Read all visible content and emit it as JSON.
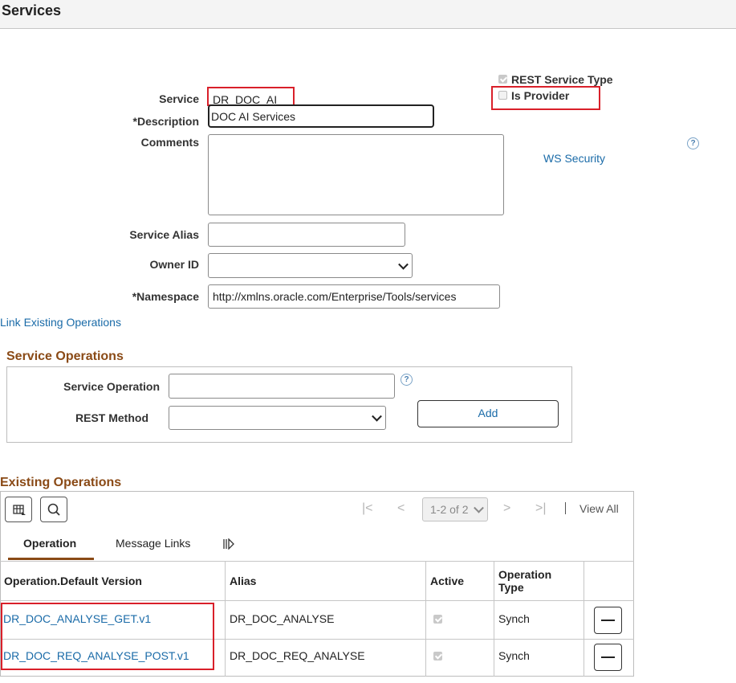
{
  "page": {
    "title": "Services"
  },
  "service_form": {
    "service_label": "Service",
    "service_value": "DR_DOC_AI",
    "description_label": "*Description",
    "description_value": "DOC AI Services",
    "comments_label": "Comments",
    "comments_value": "",
    "service_alias_label": "Service Alias",
    "service_alias_value": "",
    "owner_id_label": "Owner ID",
    "owner_id_value": "",
    "namespace_label": "*Namespace",
    "namespace_value": "http://xmlns.oracle.com/Enterprise/Tools/services",
    "rest_service_type_label": "REST Service Type",
    "rest_service_type_checked": true,
    "is_provider_label": "Is Provider",
    "is_provider_checked": false,
    "ws_security_link": "WS Security",
    "link_existing_ops": "Link Existing Operations",
    "help_glyph": "?"
  },
  "service_operations": {
    "title": "Service Operations",
    "service_operation_label": "Service Operation",
    "service_operation_value": "",
    "rest_method_label": "REST Method",
    "rest_method_value": "",
    "add_button": "Add",
    "help_glyph": "?"
  },
  "existing_operations": {
    "title": "Existing Operations",
    "pager": "1-2 of 2",
    "view_all": "View All",
    "tabs": [
      "Operation",
      "Message Links"
    ],
    "columns": [
      "Operation.Default Version",
      "Alias",
      "Active",
      "Operation Type"
    ],
    "rows": [
      {
        "operation": "DR_DOC_ANALYSE_GET.v1",
        "alias": "DR_DOC_ANALYSE",
        "active": true,
        "type": "Synch"
      },
      {
        "operation": "DR_DOC_REQ_ANALYSE_POST.v1",
        "alias": "DR_DOC_REQ_ANALYSE",
        "active": true,
        "type": "Synch"
      }
    ]
  },
  "colors": {
    "accent_brown": "#8a4a16",
    "link_blue": "#1a6ba8",
    "highlight_red": "#d9202a"
  }
}
